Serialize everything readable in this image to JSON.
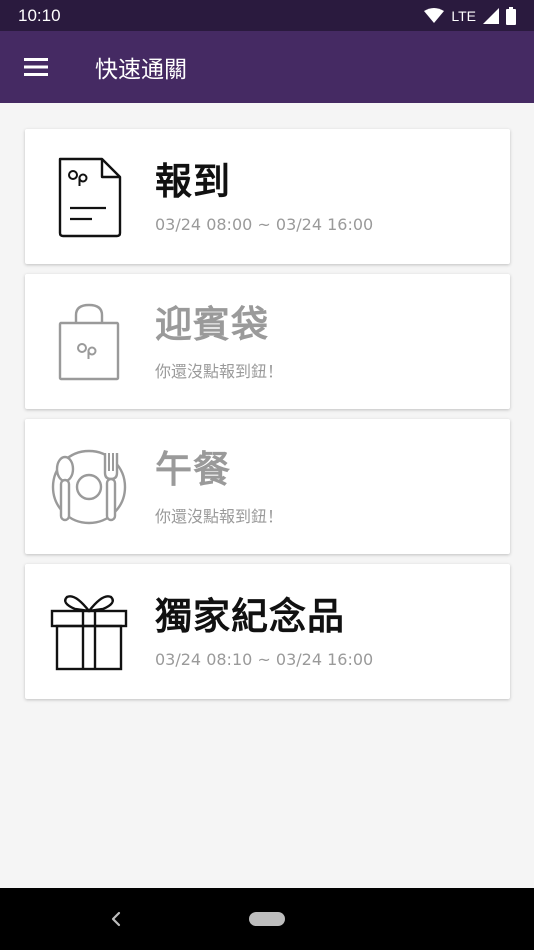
{
  "status_bar": {
    "time": "10:10",
    "network": "LTE",
    "icons": [
      "wifi-icon",
      "cell-signal-icon",
      "battery-icon"
    ]
  },
  "app_bar": {
    "title": "快速通關",
    "menu_icon": "hamburger-menu-icon",
    "background": "#452a63"
  },
  "cards": [
    {
      "icon": "document-icon",
      "title": "報到",
      "subtitle": "03/24 08:00 ~ 03/24 16:00",
      "enabled": true
    },
    {
      "icon": "gift-bag-icon",
      "title": "迎賓袋",
      "subtitle": "你還沒點報到鈕！",
      "enabled": false
    },
    {
      "icon": "plate-cutlery-icon",
      "title": "午餐",
      "subtitle": "你還沒點報到鈕！",
      "enabled": false
    },
    {
      "icon": "gift-box-icon",
      "title": "獨家紀念品",
      "subtitle": "03/24 08:10 ~ 03/24 16:00",
      "enabled": true
    }
  ],
  "nav_bar": {
    "back_icon": "back-chevron-icon",
    "home_icon": "home-pill-icon"
  }
}
